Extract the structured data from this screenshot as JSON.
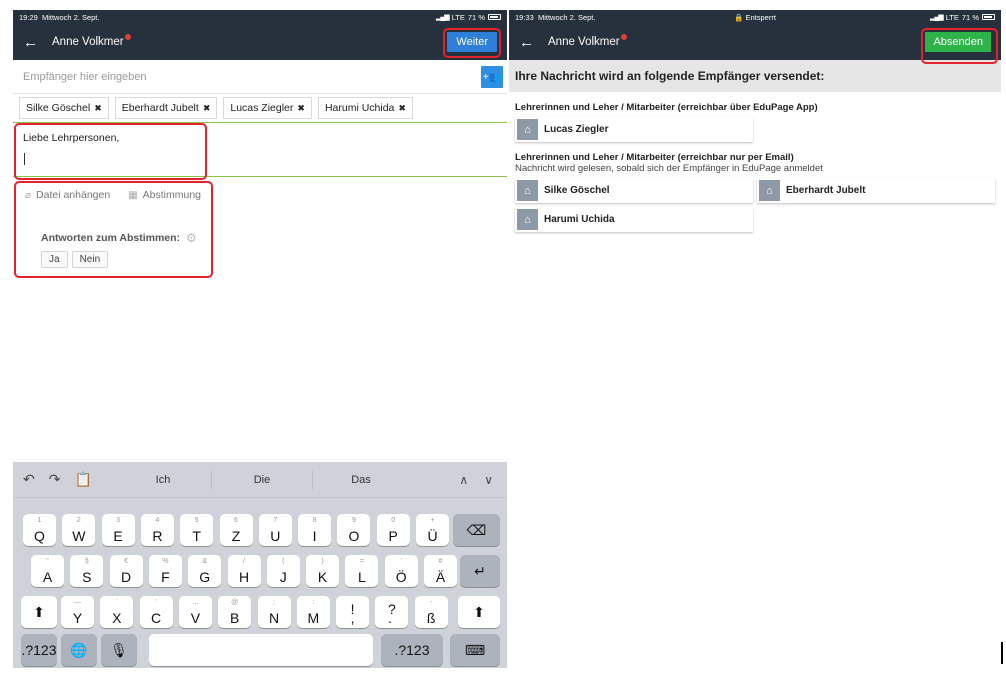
{
  "left": {
    "status": {
      "time": "19:29",
      "date": "Mittwoch 2. Sept.",
      "carrier": "LTE",
      "battery": "71 %"
    },
    "nav": {
      "back_icon": "←",
      "title": "Anne Volkmer",
      "action_label": "Weiter"
    },
    "recipient_placeholder": "Empfänger hier eingeben",
    "add_recipient_icon": "+👥",
    "chips": [
      "Silke Göschel",
      "Eberhardt Jubelt",
      "Lucas Ziegler",
      "Harumi Uchida"
    ],
    "chip_remove_icon": "✖",
    "message": "Liebe Lehrpersonen,",
    "attach_label": "Datei anhängen",
    "poll_label": "Abstimmung",
    "vote_label": "Antworten zum Abstimmen:",
    "vote_answers": [
      "Ja",
      "Nein"
    ],
    "keyboard": {
      "suggestions": [
        "Ich",
        "Die",
        "Das"
      ],
      "tools": {
        "undo": "↶",
        "redo": "↷",
        "paste": "📋"
      },
      "arrows": {
        "up": "∧",
        "down": "∨"
      },
      "row1": [
        [
          "1",
          "Q"
        ],
        [
          "2",
          "W"
        ],
        [
          "3",
          "E"
        ],
        [
          "4",
          "R"
        ],
        [
          "5",
          "T"
        ],
        [
          "6",
          "Z"
        ],
        [
          "7",
          "U"
        ],
        [
          "8",
          "I"
        ],
        [
          "9",
          "O"
        ],
        [
          "0",
          "P"
        ],
        [
          "+",
          "Ü"
        ]
      ],
      "row2": [
        [
          "\"",
          "A"
        ],
        [
          "§",
          "S"
        ],
        [
          "€",
          "D"
        ],
        [
          "%",
          "F"
        ],
        [
          "&",
          "G"
        ],
        [
          "/",
          "H"
        ],
        [
          "(",
          "J"
        ],
        [
          ")",
          "K"
        ],
        [
          "=",
          "L"
        ],
        [
          "'",
          "Ö"
        ],
        [
          "#",
          "Ä"
        ]
      ],
      "row3": [
        [
          "—",
          "Y"
        ],
        [
          "`",
          "X"
        ],
        [
          "'",
          "C"
        ],
        [
          "...",
          "V"
        ],
        [
          "@",
          "B"
        ],
        [
          ";",
          "N"
        ],
        [
          ":",
          "M"
        ],
        [
          "",
          "!\n,"
        ],
        [
          "",
          "?\n."
        ],
        [
          "-",
          "ß"
        ]
      ],
      "backspace": "⌫",
      "return": "↵",
      "shift": "⬆",
      "num_label": ".?123",
      "globe": "🌐",
      "mic": "🎙",
      "kb_hide": "⌨"
    }
  },
  "right": {
    "status": {
      "time": "19:33",
      "date": "Mittwoch 2. Sept.",
      "center": "🔒 Entsperrt",
      "carrier": "LTE",
      "battery": "71 %"
    },
    "nav": {
      "back_icon": "←",
      "title": "Anne Volkmer",
      "action_label": "Absenden"
    },
    "heading": "Ihre Nachricht wird an folgende Empfänger versendet:",
    "groups": [
      {
        "title": "Lehrerinnen und Leher / Mitarbeiter (erreichbar über EduPage App)",
        "sub": "",
        "people": [
          "Lucas Ziegler"
        ]
      },
      {
        "title": "Lehrerinnen und Leher / Mitarbeiter (erreichbar nur per Email)",
        "sub": "Nachricht wird gelesen, sobald sich der Empfänger in EduPage anmeldet",
        "people": [
          "Silke Göschel",
          "Eberhardt Jubelt",
          "Harumi Uchida"
        ]
      }
    ]
  }
}
